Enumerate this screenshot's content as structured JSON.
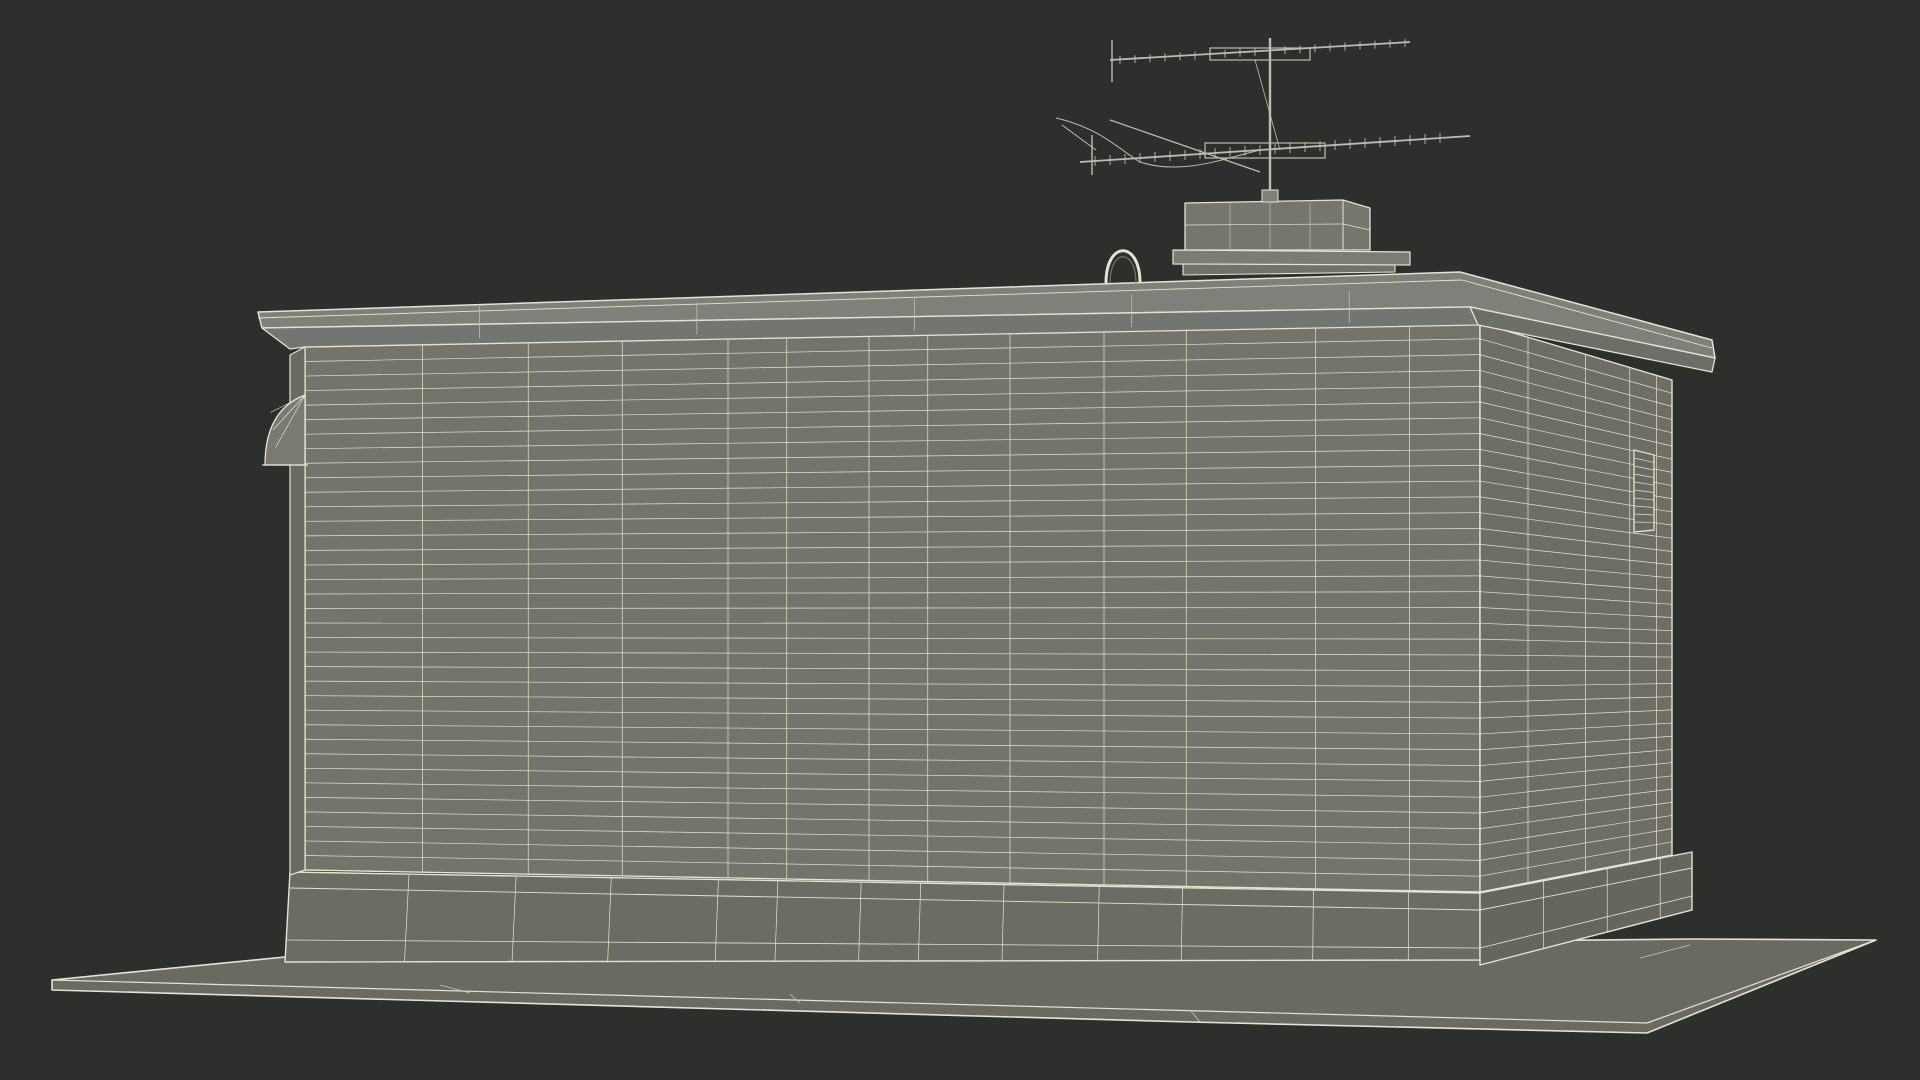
{
  "scene": {
    "subject": "wireframe-render",
    "colors": {
      "background": "#2e2e2c",
      "surface_front": "#74746c",
      "surface_side": "#6e6e66",
      "surface_top": "#80807a",
      "surface_base": "#6c6c64",
      "ground": "#6a6a62",
      "wire": "#e4e4d2",
      "wire_dim": "#c8c8b8",
      "antenna": "#bdbdb2"
    }
  }
}
